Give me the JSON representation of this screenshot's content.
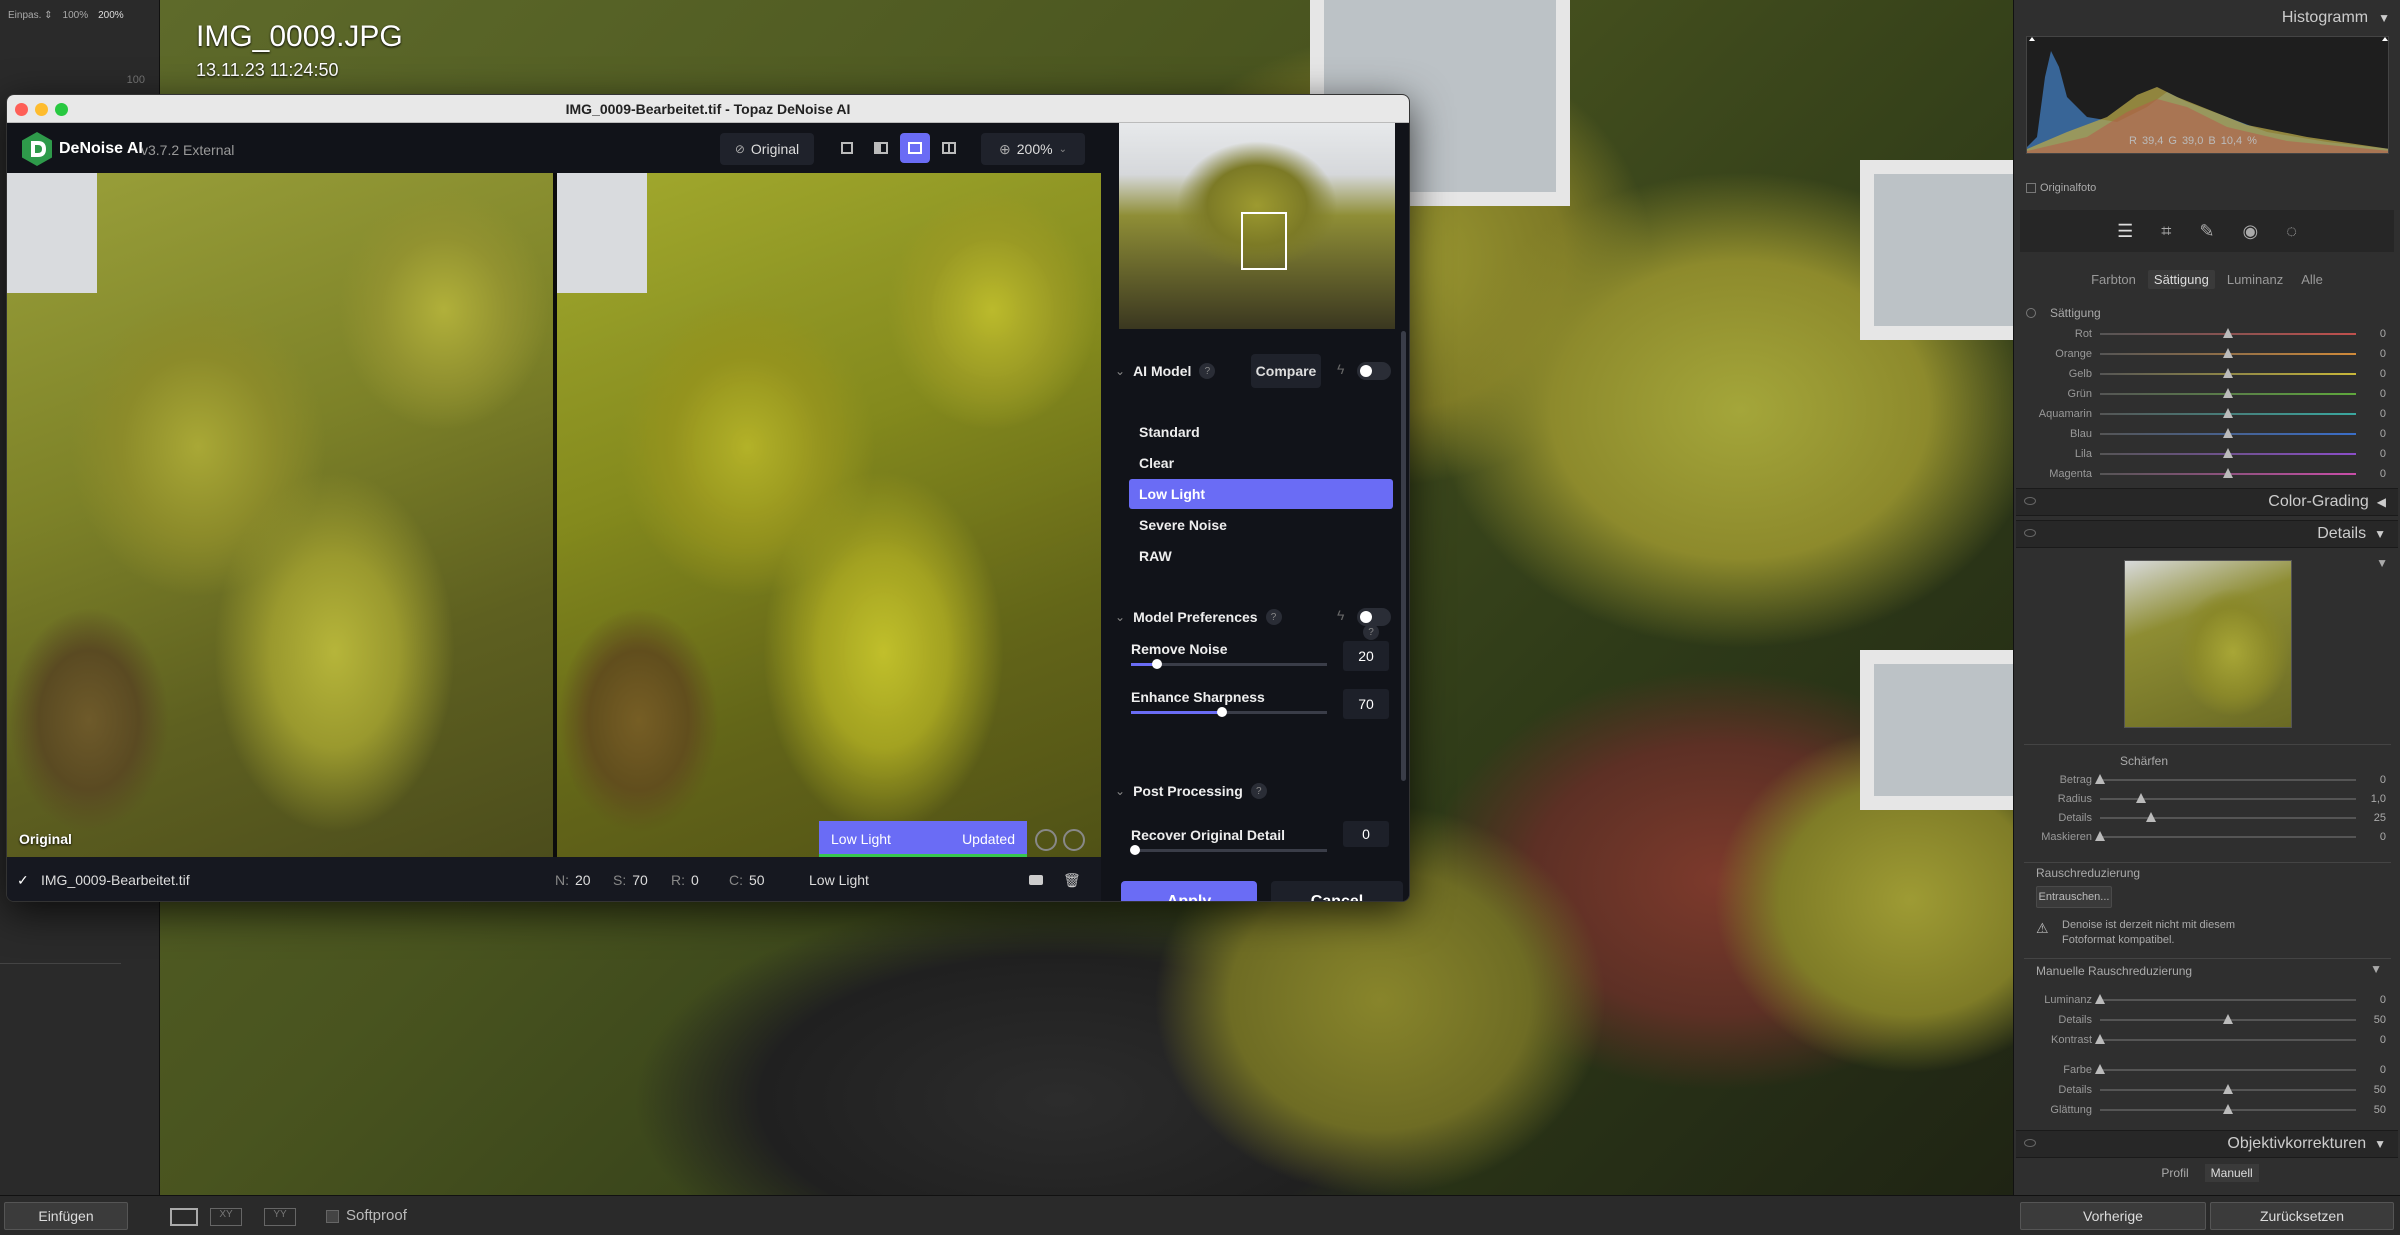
{
  "lightroom": {
    "left_panel": {
      "zoom_options": [
        "Einpas. ⇕",
        "100%",
        "200%"
      ],
      "navigator_value": "100"
    },
    "photo": {
      "filename": "IMG_0009.JPG",
      "datetime": "13.11.23 11:24:50"
    },
    "bottom_bar": {
      "paste_label": "Einfügen",
      "softproof_label": "Softproof",
      "previous_label": "Vorherige",
      "reset_label": "Zurücksetzen"
    },
    "right_panel": {
      "histogram_title": "Histogramm",
      "histogram_readout": {
        "r_label": "R",
        "r": "39,4",
        "g_label": "G",
        "g": "39,0",
        "b_label": "B",
        "b": "10,4",
        "unit": "%"
      },
      "original_photo_label": "Originalfoto",
      "hsl_tabs": [
        "Farbton",
        "Sättigung",
        "Luminanz",
        "Alle"
      ],
      "hsl_active_tab": "Sättigung",
      "saturation_heading": "Sättigung",
      "saturation_rows": [
        {
          "label": "Rot",
          "value": "0",
          "color": "#c0504d"
        },
        {
          "label": "Orange",
          "value": "0",
          "color": "#d08a3a"
        },
        {
          "label": "Gelb",
          "value": "0",
          "color": "#c9b83a"
        },
        {
          "label": "Grün",
          "value": "0",
          "color": "#5fa83c"
        },
        {
          "label": "Aquamarin",
          "value": "0",
          "color": "#3aa8a0"
        },
        {
          "label": "Blau",
          "value": "0",
          "color": "#3a6ec9"
        },
        {
          "label": "Lila",
          "value": "0",
          "color": "#8a4ec9"
        },
        {
          "label": "Magenta",
          "value": "0",
          "color": "#c94ea8"
        }
      ],
      "color_grading_title": "Color-Grading",
      "details_title": "Details",
      "sharpen_heading": "Schärfen",
      "sharpen_rows": [
        {
          "label": "Betrag",
          "value": "0"
        },
        {
          "label": "Radius",
          "value": "1,0"
        },
        {
          "label": "Details",
          "value": "25"
        },
        {
          "label": "Maskieren",
          "value": "0"
        }
      ],
      "noise_heading": "Rauschreduzierung",
      "denoise_button": "Entrauschen...",
      "denoise_warning_line1": "Denoise ist derzeit nicht mit diesem",
      "denoise_warning_line2": "Fotoformat kompatibel.",
      "manual_noise_heading": "Manuelle Rauschreduzierung",
      "manual_noise_rows": [
        {
          "label": "Luminanz",
          "value": "0"
        },
        {
          "label": "Details",
          "value": "50"
        },
        {
          "label": "Kontrast",
          "value": "0"
        },
        {
          "label": "Farbe",
          "value": "0"
        },
        {
          "label": "Details",
          "value": "50"
        },
        {
          "label": "Glättung",
          "value": "50"
        }
      ],
      "lens_title": "Objektivkorrekturen",
      "lens_tabs": [
        "Profil",
        "Manuell"
      ]
    }
  },
  "topaz": {
    "window_title": "IMG_0009-Bearbeitet.tif - Topaz DeNoise AI",
    "app_name": "DeNoise AI",
    "version": "v3.7.2 External",
    "original_button": "Original",
    "zoom": "200%",
    "original_pane_label": "Original",
    "preview_model": "Low Light",
    "preview_status": "Updated",
    "status": {
      "filename": "IMG_0009-Bearbeitet.tif",
      "n_label": "N:",
      "n": "20",
      "s_label": "S:",
      "s": "70",
      "r_label": "R:",
      "r": "0",
      "c_label": "C:",
      "c": "50",
      "model": "Low Light"
    },
    "ai_model": {
      "heading": "AI Model",
      "compare_button": "Compare",
      "models": [
        "Standard",
        "Clear",
        "Low Light",
        "Severe Noise",
        "RAW"
      ],
      "selected": "Low Light"
    },
    "preferences": {
      "heading": "Model Preferences",
      "remove_noise_label": "Remove Noise",
      "remove_noise": 20,
      "enhance_sharpness_label": "Enhance Sharpness",
      "enhance_sharpness": 70
    },
    "post_processing": {
      "heading": "Post Processing",
      "recover_detail_label": "Recover Original Detail",
      "recover_detail": 0
    },
    "apply_button": "Apply",
    "cancel_button": "Cancel",
    "accent_color": "#6a6cf5"
  }
}
